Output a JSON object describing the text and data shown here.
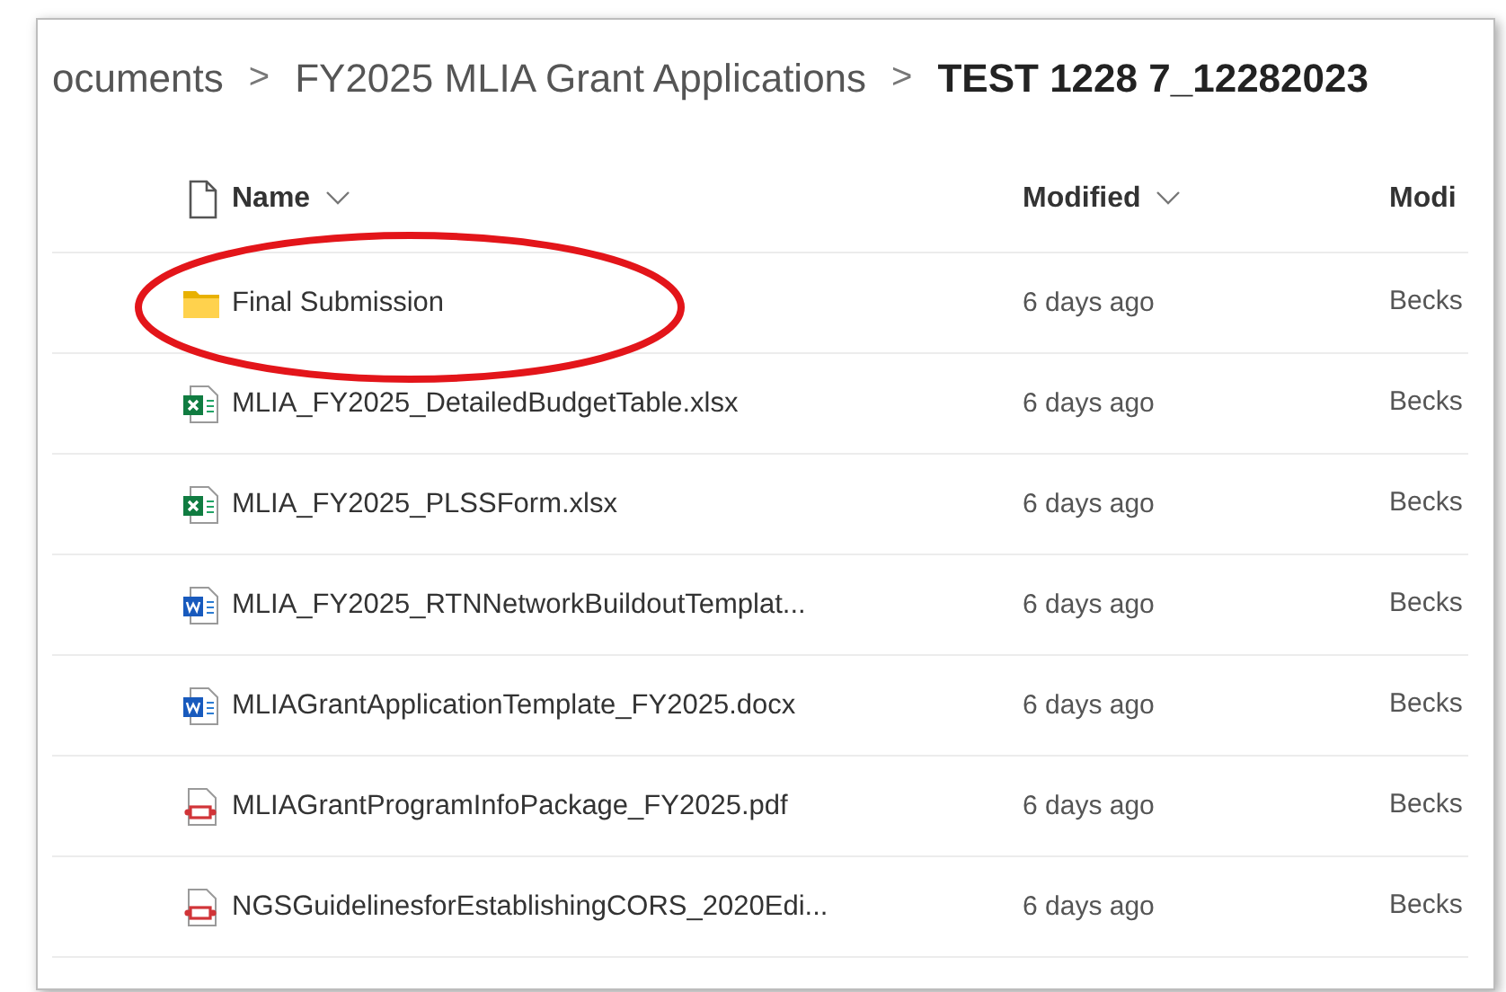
{
  "breadcrumb": [
    {
      "label": "ocuments",
      "current": false
    },
    {
      "label": "FY2025 MLIA Grant Applications",
      "current": false
    },
    {
      "label": "TEST 1228 7_12282023",
      "current": true
    }
  ],
  "breadcrumb_separator": ">",
  "table": {
    "columns": [
      {
        "label": "Name",
        "sortable": true
      },
      {
        "label": "Modified",
        "sortable": true
      },
      {
        "label": "Modi",
        "sortable": false
      }
    ],
    "rows": [
      {
        "kind": "folder",
        "name": "Final Submission",
        "modified": "6 days ago",
        "column_3": "Becks"
      },
      {
        "kind": "excel",
        "name": "MLIA_FY2025_DetailedBudgetTable.xlsx",
        "modified": "6 days ago",
        "column_3": "Becks"
      },
      {
        "kind": "excel",
        "name": "MLIA_FY2025_PLSSForm.xlsx",
        "modified": "6 days ago",
        "column_3": "Becks"
      },
      {
        "kind": "word",
        "name": "MLIA_FY2025_RTNNetworkBuildoutTemplat...",
        "modified": "6 days ago",
        "column_3": "Becks"
      },
      {
        "kind": "word",
        "name": "MLIAGrantApplicationTemplate_FY2025.docx",
        "modified": "6 days ago",
        "column_3": "Becks"
      },
      {
        "kind": "pdf",
        "name": "MLIAGrantProgramInfoPackage_FY2025.pdf",
        "modified": "6 days ago",
        "column_3": "Becks"
      },
      {
        "kind": "pdf",
        "name": "NGSGuidelinesforEstablishingCORS_2020Edi...",
        "modified": "6 days ago",
        "column_3": "Becks"
      }
    ]
  },
  "annotation": {
    "kind": "ellipse",
    "color": "#e3151a"
  }
}
